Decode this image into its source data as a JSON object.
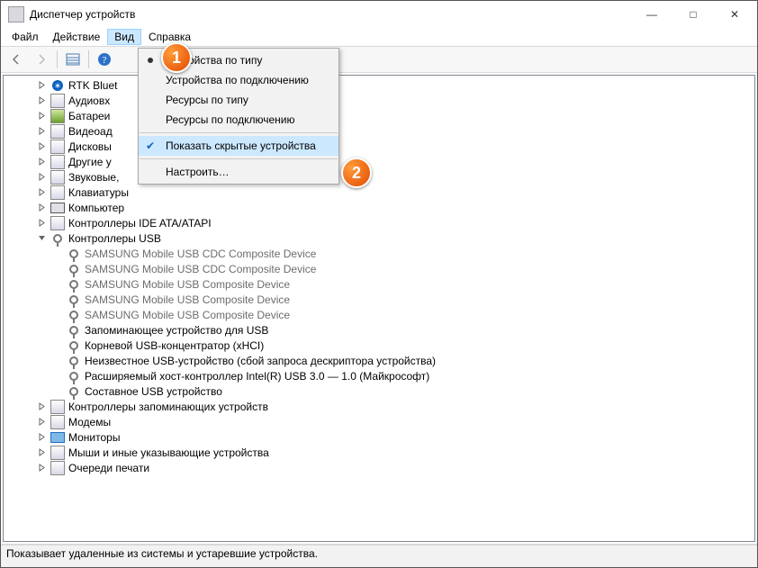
{
  "window": {
    "title": "Диспетчер устройств"
  },
  "winbtn": {
    "min": "—",
    "max": "□",
    "close": "✕"
  },
  "menu": {
    "file": "Файл",
    "action": "Действие",
    "view": "Вид",
    "help": "Справка"
  },
  "viewmenu": {
    "by_type": "Устройства по типу",
    "by_conn": "Устройства по подключению",
    "res_type": "Ресурсы по типу",
    "res_conn": "Ресурсы по подключению",
    "show_hidden": "Показать скрытые устройства",
    "customize": "Настроить…"
  },
  "badge": {
    "one": "1",
    "two": "2"
  },
  "tree": {
    "rtk": "RTK Bluet",
    "audio": "Аудиовх",
    "batt": "Батареи",
    "video": "Видеоад",
    "disk": "Дисковы",
    "other": "Другие у",
    "sound": "Звуковые,",
    "sound_tail": "...",
    "kbd": "Клавиатуры",
    "pc": "Компьютер",
    "ide": "Контроллеры IDE ATA/ATAPI",
    "usb": "Контроллеры USB",
    "usb_items": [
      "SAMSUNG Mobile USB CDC Composite Device",
      "SAMSUNG Mobile USB CDC Composite Device",
      "SAMSUNG Mobile USB Composite Device",
      "SAMSUNG Mobile USB Composite Device",
      "SAMSUNG Mobile USB Composite Device",
      "Запоминающее устройство для USB",
      "Корневой USB-концентратор (xHCI)",
      "Неизвестное USB-устройство (сбой запроса дескриптора устройства)",
      "Расширяемый хост-контроллер Intel(R) USB 3.0 — 1.0 (Майкрософт)",
      "Составное USB устройство"
    ],
    "usb_faded": [
      true,
      true,
      true,
      true,
      true,
      false,
      false,
      false,
      false,
      false
    ],
    "storage": "Контроллеры запоминающих устройств",
    "modem": "Модемы",
    "monitors": "Мониторы",
    "mice": "Мыши и иные указывающие устройства",
    "print": "Очереди печати"
  },
  "status": "Показывает удаленные из системы и устаревшие устройства."
}
